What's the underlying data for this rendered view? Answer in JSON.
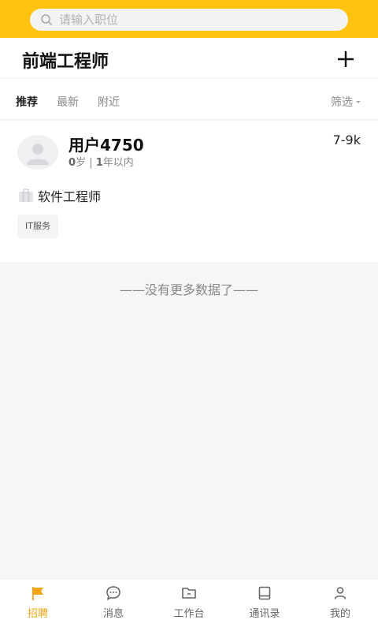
{
  "search": {
    "placeholder": "请输入职位"
  },
  "header": {
    "title": "前端工程师",
    "add_label": "+"
  },
  "tabs": [
    {
      "label": "推荐",
      "active": true
    },
    {
      "label": "最新",
      "active": false
    },
    {
      "label": "附近",
      "active": false
    }
  ],
  "filter": {
    "label": "筛选"
  },
  "candidates": [
    {
      "name": "用户4750",
      "age": "0",
      "age_unit": "岁",
      "separator": "|",
      "experience_num": "1",
      "experience_text": "年以内",
      "salary": "7-9k",
      "job_title": "软件工程师",
      "tag": "IT服务"
    }
  ],
  "list_end_text": "——没有更多数据了——",
  "bottom_nav": [
    {
      "label": "招聘",
      "icon": "flag-icon",
      "active": true
    },
    {
      "label": "消息",
      "icon": "chat-icon",
      "active": false
    },
    {
      "label": "工作台",
      "icon": "folder-icon",
      "active": false
    },
    {
      "label": "通讯录",
      "icon": "book-icon",
      "active": false
    },
    {
      "label": "我的",
      "icon": "person-icon",
      "active": false
    }
  ],
  "colors": {
    "brand": "#ffc20e",
    "nav_active": "#f2a612"
  }
}
